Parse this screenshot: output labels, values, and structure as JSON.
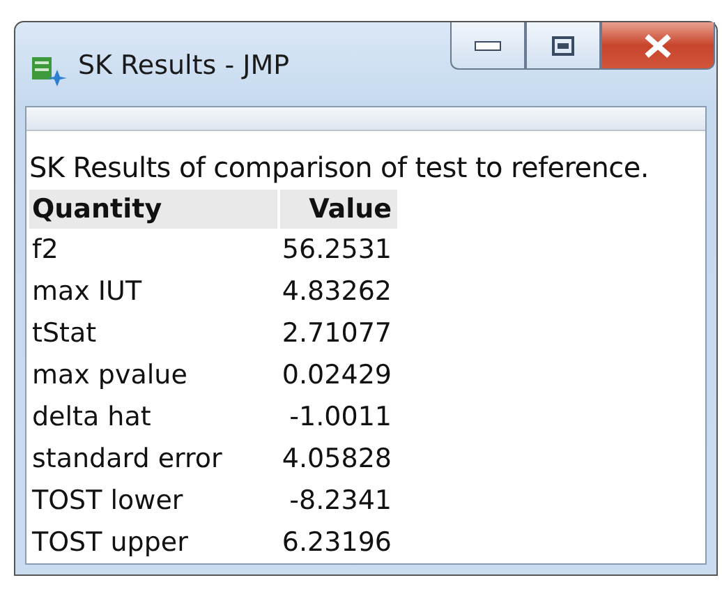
{
  "window": {
    "title": "SK Results - JMP"
  },
  "report": {
    "caption": "SK Results of comparison of test to reference.",
    "columns": [
      "Quantity",
      "Value"
    ],
    "rows": [
      {
        "quantity": "f2",
        "value": "56.2531"
      },
      {
        "quantity": "max IUT",
        "value": "4.83262"
      },
      {
        "quantity": "tStat",
        "value": "2.71077"
      },
      {
        "quantity": "max pvalue",
        "value": "0.02429"
      },
      {
        "quantity": "delta hat",
        "value": "-1.0011"
      },
      {
        "quantity": "standard error",
        "value": "4.05828"
      },
      {
        "quantity": "TOST lower",
        "value": "-8.2341"
      },
      {
        "quantity": "TOST upper",
        "value": "6.23196"
      }
    ]
  }
}
